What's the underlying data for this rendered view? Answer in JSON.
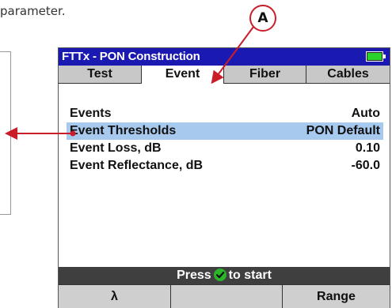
{
  "doc": {
    "intro_text": "parameter."
  },
  "callout": {
    "label": "A"
  },
  "window": {
    "title": "FTTx - PON Construction",
    "battery_level": 1.0
  },
  "tabs": [
    {
      "label": "Test"
    },
    {
      "label": "Event",
      "active": true
    },
    {
      "label": "Fiber"
    },
    {
      "label": "Cables"
    }
  ],
  "settings": [
    {
      "label": "Events",
      "value": "Auto"
    },
    {
      "label": "Event Thresholds",
      "value": "PON Default",
      "selected": true
    },
    {
      "label": "Event Loss, dB",
      "value": "0.10"
    },
    {
      "label": "Event Reflectance, dB",
      "value": "-60.0"
    }
  ],
  "status": {
    "before": "Press",
    "after": "to start"
  },
  "softkeys": [
    {
      "label": "λ"
    },
    {
      "label": ""
    },
    {
      "label": ""
    },
    {
      "label": "Range"
    }
  ],
  "colors": {
    "title_bar": "#1a1ab3",
    "selection": "#a7c9ee",
    "annotation": "#c91e2a",
    "battery": "#2bd22b",
    "check": "#2bb52b"
  }
}
